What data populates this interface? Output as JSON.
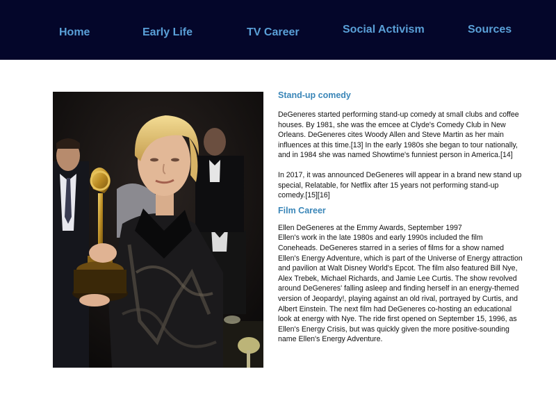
{
  "nav": {
    "home": "Home",
    "early_life": "Early Life",
    "tv_career": "TV Career",
    "social_activism": "Social Activism",
    "sources": "Sources"
  },
  "colors": {
    "nav_background": "#04062a",
    "nav_link": "#5aa0d8",
    "heading": "#3a86b8"
  },
  "photo": {
    "icon": "emmy-award-photo"
  },
  "content": {
    "standup_heading": "Stand-up comedy",
    "standup_p1": "DeGeneres started performing stand-up comedy at small clubs and coffee houses. By 1981, she was the emcee at Clyde's Comedy Club in New Orleans. DeGeneres cites Woody Allen and Steve Martin as her main influences at this time.[13] In the early 1980s she began to tour nationally, and in 1984 she was named Showtime's funniest person in America.[14]",
    "standup_p2": "In 2017, it was announced DeGeneres will appear in a brand new stand up special, Relatable, for Netflix after 15 years not performing stand-up comedy.[15][16]",
    "film_heading": "Film Career",
    "film_caption": "Ellen DeGeneres at the Emmy Awards, September 1997",
    "film_p1": "Ellen's work in the late 1980s and early 1990s included the film Coneheads. DeGeneres starred in a series of films for a show named Ellen's Energy Adventure, which is part of the Universe of Energy attraction and pavilion at Walt Disney World's Epcot. The film also featured Bill Nye, Alex Trebek, Michael Richards, and Jamie Lee Curtis. The show revolved around DeGeneres' falling asleep and finding herself in an energy-themed version of Jeopardy!, playing against an old rival, portrayed by Curtis, and Albert Einstein. The next film had DeGeneres co-hosting an educational look at energy with Nye. The ride first opened on September 15, 1996, as Ellen's Energy Crisis, but was quickly given the more positive-sounding name Ellen's Energy Adventure."
  }
}
